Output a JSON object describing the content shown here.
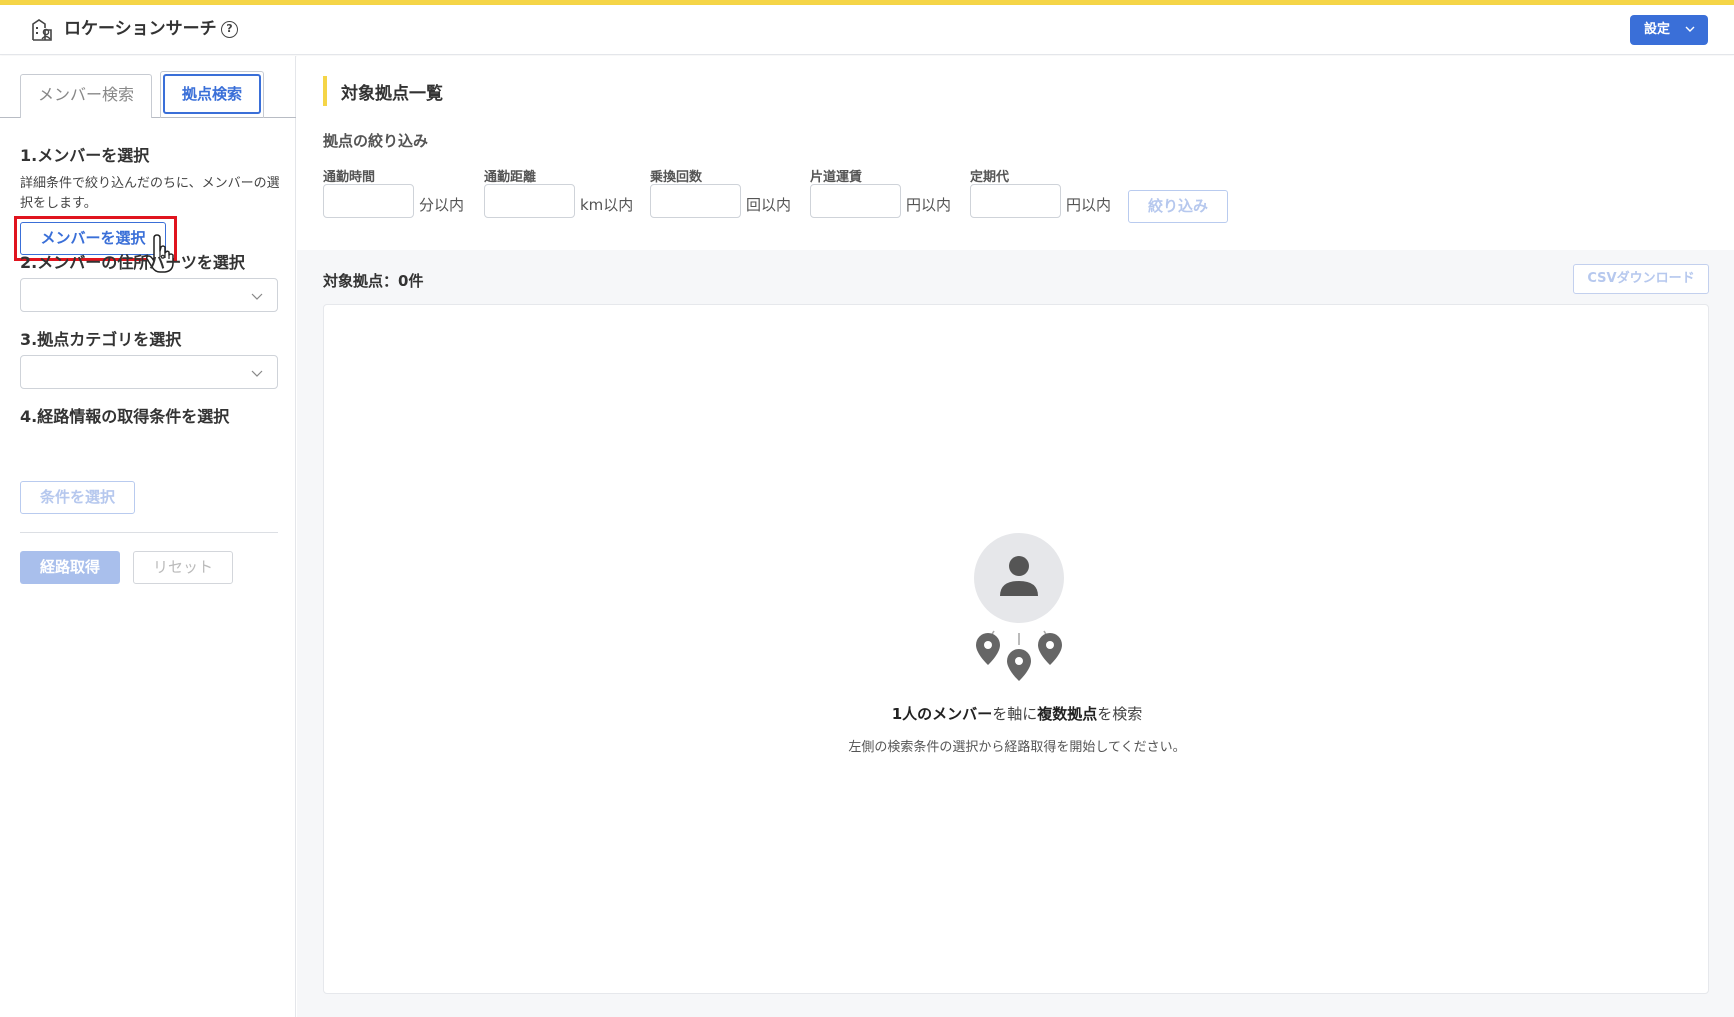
{
  "header": {
    "title": "ロケーションサーチ",
    "help_glyph": "?",
    "settings_label": "設定",
    "accent_color": "#f5d547",
    "primary_color": "#3a6fd8"
  },
  "sidebar": {
    "tabs": [
      {
        "label": "メンバー検索",
        "active": false
      },
      {
        "label": "拠点検索",
        "active": true
      }
    ],
    "step1": {
      "title": "1.メンバーを選択",
      "description": "詳細条件で絞り込んだのちに、メンバーの選択をします。",
      "button_label": "メンバーを選択"
    },
    "step2": {
      "title": "2.メンバーの住所パーツを選択",
      "selected": ""
    },
    "step3": {
      "title": "3.拠点カテゴリを選択",
      "selected": ""
    },
    "step4": {
      "title": "4.経路情報の取得条件を選択",
      "button_label": "条件を選択"
    },
    "route_button_label": "経路取得",
    "reset_button_label": "リセット"
  },
  "main": {
    "section_title": "対象拠点一覧",
    "filter_title": "拠点の絞り込み",
    "filters": [
      {
        "label": "通勤時間",
        "unit": "分以内",
        "value": ""
      },
      {
        "label": "通勤距離",
        "unit": "km以内",
        "value": ""
      },
      {
        "label": "乗換回数",
        "unit": "回以内",
        "value": ""
      },
      {
        "label": "片道運賃",
        "unit": "円以内",
        "value": ""
      },
      {
        "label": "定期代",
        "unit": "円以内",
        "value": ""
      }
    ],
    "narrow_button_label": "絞り込み",
    "results_count": "対象拠点：0件",
    "csv_button_label": "CSVダウンロード",
    "empty_state": {
      "title_part1": "1人のメンバー",
      "title_part2": "を軸に",
      "title_part3": "複数拠点",
      "title_part4": "を検索",
      "subtitle": "左側の検索条件の選択から経路取得を開始してください。"
    }
  }
}
